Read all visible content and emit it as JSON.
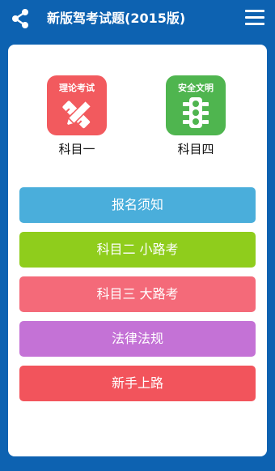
{
  "header": {
    "title": "新版驾考试题(2015版)",
    "share_icon": "share-icon",
    "menu_icon": "hamburger-menu-icon"
  },
  "subjects": [
    {
      "badge": "理论考试",
      "label": "科目一",
      "icon": "pencil-ruler-icon",
      "color": "#f25a5e"
    },
    {
      "badge": "安全文明",
      "label": "科目四",
      "icon": "traffic-light-icon",
      "color": "#4fb54f"
    }
  ],
  "menu": [
    {
      "label": "报名须知",
      "color": "#4aaedb"
    },
    {
      "label": "科目二 小路考",
      "color": "#8fcd1c"
    },
    {
      "label": "科目三 大路考",
      "color": "#f46a79"
    },
    {
      "label": "法律法规",
      "color": "#c472d6"
    },
    {
      "label": "新手上路",
      "color": "#f2545c"
    }
  ],
  "colors": {
    "bar": "#0d62b1",
    "card": "#ffffff"
  }
}
